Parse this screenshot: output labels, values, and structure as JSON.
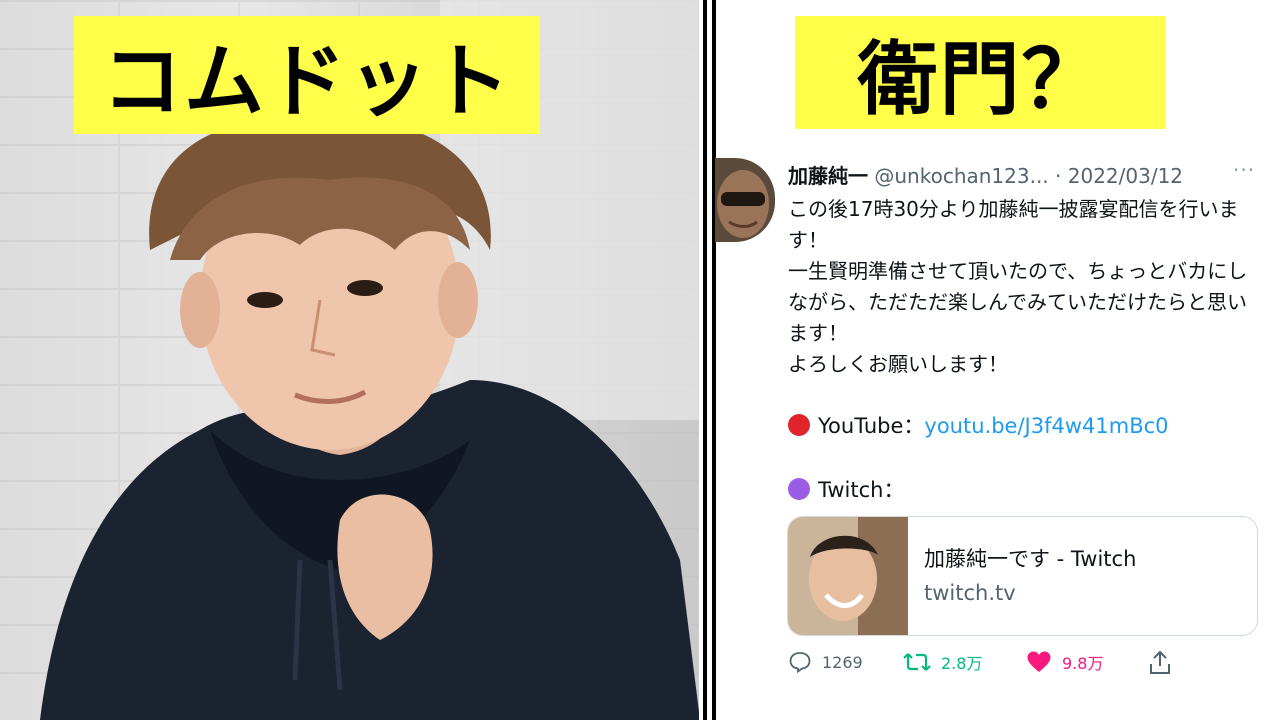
{
  "left": {
    "label": "コムドット"
  },
  "right": {
    "label": "衛門？"
  },
  "tweet": {
    "author_name": "加藤純一",
    "handle": "@unkochan123...",
    "separator": "·",
    "date": "2022/03/12",
    "more": "···",
    "body_lines": [
      "この後17時30分より加藤純一披露宴配信を行います！",
      "一生賢明準備させて頂いたので、ちょっとバカにしながら、ただただ楽しんでみていただけたらと思います！",
      "よろしくお願いします！"
    ],
    "youtube_label": "YouTube：",
    "youtube_link": "youtu.be/J3f4w41mBc0",
    "twitch_label": "Twitch：",
    "card_title": "加藤純一です - Twitch",
    "card_domain": "twitch.tv",
    "replies": "1269",
    "retweets": "2.8万",
    "likes": "9.8万"
  },
  "colors": {
    "label_bg": "#ffff4a",
    "link": "#1d9bf0",
    "retweet": "#00ba7c",
    "like": "#f91880",
    "youtube_dot": "#e0242b",
    "twitch_dot": "#9b5de5"
  }
}
